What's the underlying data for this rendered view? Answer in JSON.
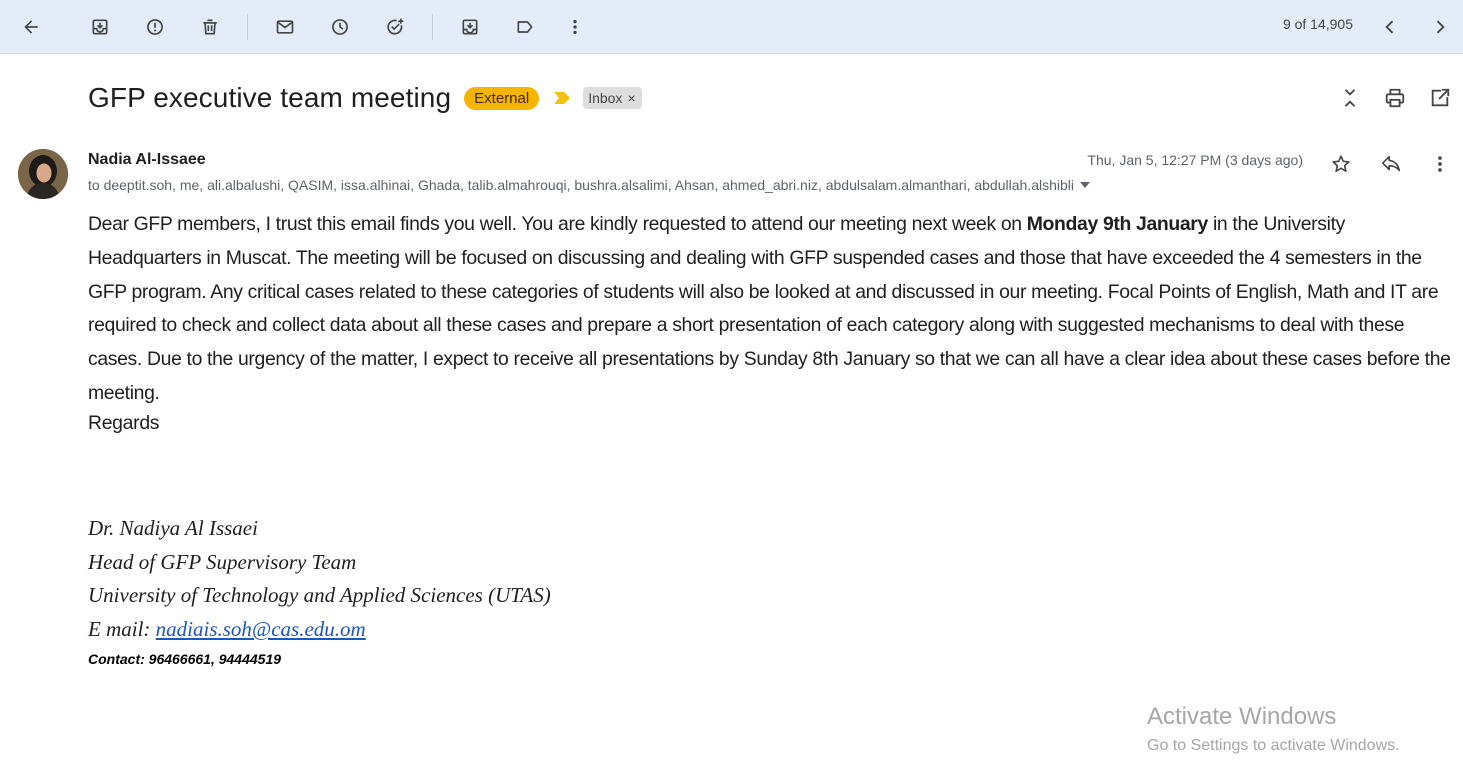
{
  "toolbar": {
    "pager_text": "9 of 14,905",
    "icons": [
      "back-arrow-icon",
      "archive-icon",
      "report-spam-icon",
      "delete-icon",
      "mark-unread-icon",
      "snooze-icon",
      "add-task-icon",
      "move-to-icon",
      "label-icon",
      "more-vert-icon",
      "chevron-left-icon",
      "chevron-right-icon"
    ]
  },
  "email": {
    "subject": "GFP executive team meeting",
    "external_label": "External",
    "inbox_label": "Inbox",
    "inbox_remove": "×",
    "sender_name": "Nadia Al-Issaee",
    "recipients": "to deeptit.soh, me, ali.albalushi, QASIM, issa.alhinai, Ghada, talib.almahrouqi, bushra.alsalimi, Ahsan, ahmed_abri.niz, abdulsalam.almanthari, abdullah.alshibli",
    "date": "Thu, Jan 5, 12:27 PM (3 days ago)",
    "body_before_bold": "Dear GFP members, I trust this email finds you well. You are kindly requested to attend our meeting next week on ",
    "body_bold": "Monday 9th January",
    "body_after_bold": " in the University Headquarters in Muscat. The meeting will be focused on discussing and dealing with GFP suspended cases and those that have exceeded the 4 semesters in the GFP program. Any critical cases related to these categories of students will also be looked at and discussed in our meeting. Focal Points of English, Math and IT are required to check and collect data about all these cases and prepare a short presentation of each category along with suggested mechanisms to deal with these cases. Due to the urgency of the matter, I expect to receive all presentations by Sunday 8th January so that we can all have a clear idea about these cases before the meeting.",
    "regards": "Regards",
    "signature": {
      "name": "Dr. Nadiya Al Issaei",
      "title": "Head of GFP Supervisory Team",
      "org": "University of Technology and Applied Sciences (UTAS)",
      "email_label": "E mail: ",
      "email": "nadiais.soh@cas.edu.om",
      "contact": "Contact: 96466661, 94444519"
    }
  },
  "watermark": {
    "title": "Activate Windows",
    "subtitle": "Go to Settings to activate Windows."
  },
  "colors": {
    "toolbar_bg": "#e3ecf8",
    "external_badge": "#f6b400",
    "importance_marker": "#f4c20d",
    "link": "#1a56c4"
  }
}
